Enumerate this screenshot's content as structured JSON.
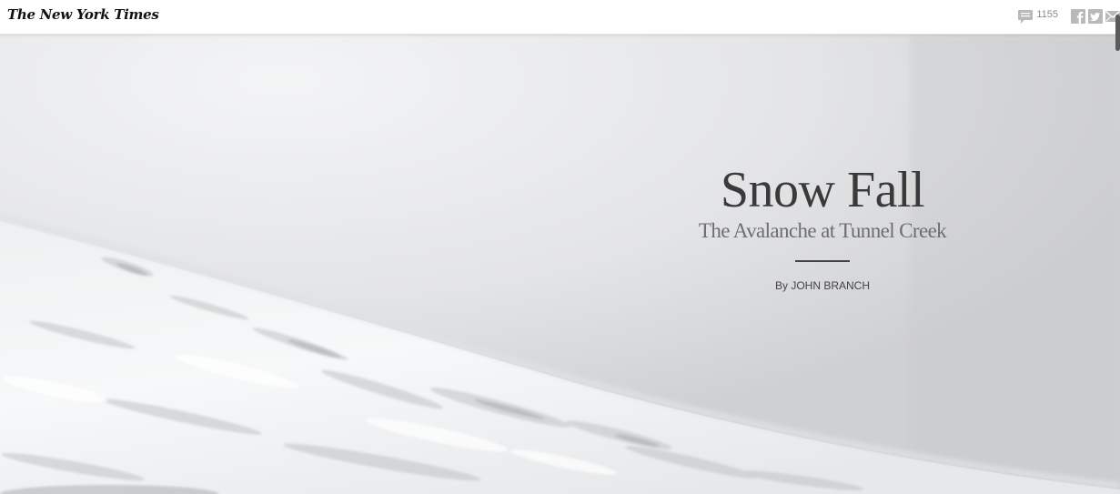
{
  "header": {
    "logo_text": "The New York Times",
    "comments": {
      "icon": "speech-bubble-icon",
      "count": "1155"
    },
    "share": [
      {
        "icon": "facebook-icon"
      },
      {
        "icon": "twitter-icon"
      },
      {
        "icon": "email-icon"
      }
    ]
  },
  "hero": {
    "title": "Snow Fall",
    "subtitle": "The Avalanche at Tunnel Creek",
    "byline": "By JOHN BRANCH"
  },
  "colors": {
    "icon_gray": "#b9b9b9",
    "text_dark": "#3a3a3a",
    "sky": "#e4e5e7",
    "snow": "#f4f5f6"
  }
}
